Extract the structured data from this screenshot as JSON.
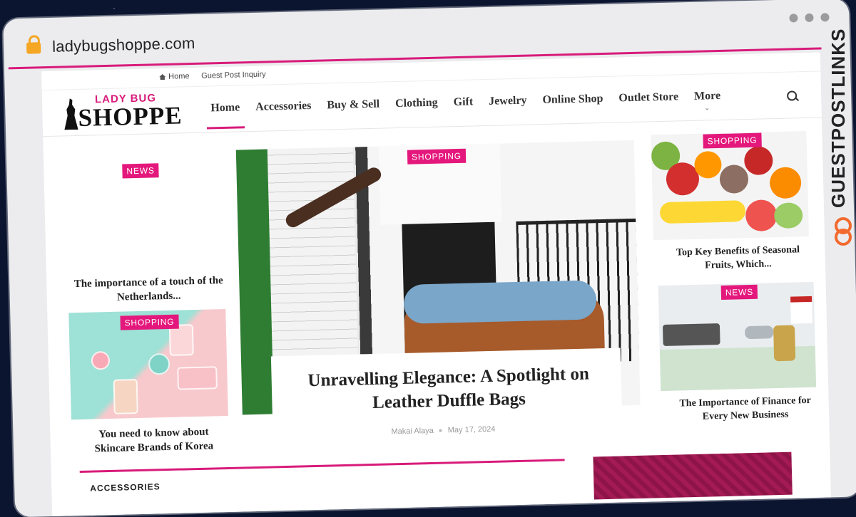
{
  "browser": {
    "url": "ladybugshoppe.com"
  },
  "topbar": {
    "home": "Home",
    "guest_post": "Guest Post Inquiry"
  },
  "logo": {
    "top": "LADY BUG",
    "bottom": "SHOPPE"
  },
  "nav": {
    "items": [
      "Home",
      "Accessories",
      "Buy & Sell",
      "Clothing",
      "Gift",
      "Jewelry",
      "Online Shop",
      "Outlet Store",
      "More"
    ]
  },
  "left": {
    "card1": {
      "badge": "NEWS",
      "title": "The importance of a touch of the Netherlands..."
    },
    "card2": {
      "badge": "SHOPPING",
      "title": "You need to know about Skincare Brands of Korea"
    }
  },
  "hero": {
    "badge": "SHOPPING",
    "title": "Unravelling Elegance: A Spotlight on Leather Duffle Bags",
    "author": "Makai Alaya",
    "date": "May 17, 2024"
  },
  "right": {
    "card1": {
      "badge": "SHOPPING",
      "title": "Top Key Benefits of Seasonal Fruits, Which..."
    },
    "card2": {
      "badge": "NEWS",
      "title": "The Importance of Finance for Every New Business"
    }
  },
  "section": {
    "title": "ACCESSORIES"
  },
  "watermark": {
    "text": "GUESTPOSTLINKS"
  },
  "colors": {
    "accent": "#e4187c",
    "watermark_icon": "#f26a2e"
  }
}
